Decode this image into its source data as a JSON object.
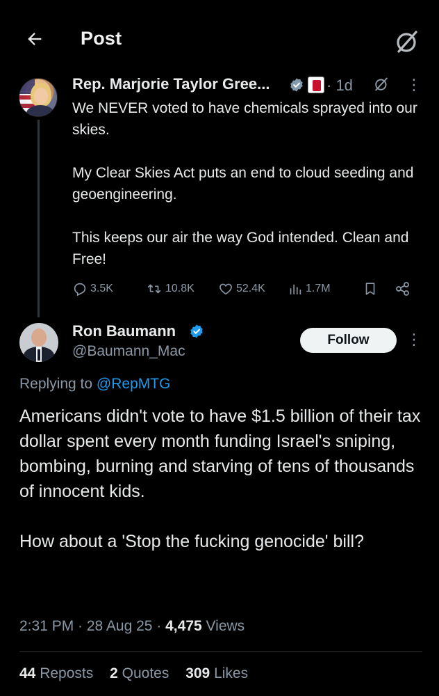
{
  "header": {
    "title": "Post"
  },
  "original_post": {
    "author_name": "Rep. Marjorie Taylor Gree...",
    "time": "· 1d",
    "paragraphs": [
      "We NEVER voted to have chemicals sprayed into our skies.",
      "My Clear Skies Act puts an end to cloud seeding and geoengineering.",
      "This keeps our air the way God intended. Clean and Free!"
    ],
    "replies": "3.5K",
    "reposts": "10.8K",
    "likes": "52.4K",
    "views": "1.7M"
  },
  "reply_post": {
    "author_name": "Ron Baumann",
    "handle": "@Baumann_Mac",
    "follow_label": "Follow",
    "replying_prefix": "Replying to ",
    "replying_to": "@RepMTG",
    "paragraphs": [
      "Americans didn't vote to have $1.5 billion of their tax dollar spent every month funding Israel's sniping, bombing, burning and starving of tens of thousands of innocent kids.",
      "How about a 'Stop the fucking genocide' bill?"
    ],
    "timestamp": "2:31 PM · 28 Aug 25 · ",
    "views_count": "4,475",
    "views_label": " Views",
    "reposts_count": "44",
    "reposts_label": "Reposts",
    "quotes_count": "2",
    "quotes_label": "Quotes",
    "likes_count": "309",
    "likes_label": "Likes"
  },
  "colors": {
    "background": "#000000",
    "text": "#e7e9ea",
    "muted": "#8b98a5",
    "link": "#1d9bf0",
    "verified_blue": "#1d9bf0",
    "verified_grey": "#829aab"
  },
  "icons": {
    "back": "arrow-left-icon",
    "grok": "grok-icon",
    "reply": "comment-icon",
    "repost": "repost-icon",
    "like": "heart-icon",
    "views": "analytics-icon",
    "bookmark": "bookmark-icon",
    "share": "share-icon"
  }
}
